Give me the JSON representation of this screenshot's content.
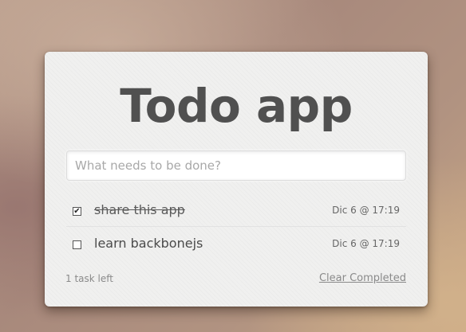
{
  "app": {
    "title": "Todo app"
  },
  "new_todo": {
    "placeholder": "What needs to be done?",
    "value": ""
  },
  "todos": [
    {
      "checked": true,
      "check_glyph": "✔",
      "text": "share this app",
      "date": "Dic 6 @ 17:19"
    },
    {
      "checked": false,
      "check_glyph": "",
      "text": "learn backbonejs",
      "date": "Dic 6 @ 17:19"
    }
  ],
  "footer": {
    "remaining": "1 task left",
    "clear_label": "Clear Completed"
  },
  "colors": {
    "title": "#505050",
    "card": "#f0f0ef",
    "muted_text": "#8a8a8a"
  }
}
